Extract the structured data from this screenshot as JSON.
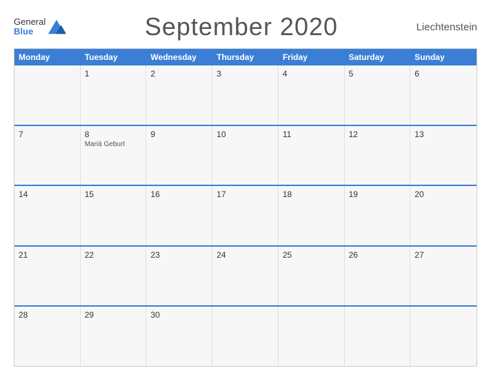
{
  "header": {
    "logo_general": "General",
    "logo_blue": "Blue",
    "title": "September 2020",
    "country": "Liechtenstein"
  },
  "weekdays": [
    "Monday",
    "Tuesday",
    "Wednesday",
    "Thursday",
    "Friday",
    "Saturday",
    "Sunday"
  ],
  "weeks": [
    [
      {
        "day": "",
        "event": ""
      },
      {
        "day": "1",
        "event": ""
      },
      {
        "day": "2",
        "event": ""
      },
      {
        "day": "3",
        "event": ""
      },
      {
        "day": "4",
        "event": ""
      },
      {
        "day": "5",
        "event": ""
      },
      {
        "day": "6",
        "event": ""
      }
    ],
    [
      {
        "day": "7",
        "event": ""
      },
      {
        "day": "8",
        "event": "Mariä Geburt"
      },
      {
        "day": "9",
        "event": ""
      },
      {
        "day": "10",
        "event": ""
      },
      {
        "day": "11",
        "event": ""
      },
      {
        "day": "12",
        "event": ""
      },
      {
        "day": "13",
        "event": ""
      }
    ],
    [
      {
        "day": "14",
        "event": ""
      },
      {
        "day": "15",
        "event": ""
      },
      {
        "day": "16",
        "event": ""
      },
      {
        "day": "17",
        "event": ""
      },
      {
        "day": "18",
        "event": ""
      },
      {
        "day": "19",
        "event": ""
      },
      {
        "day": "20",
        "event": ""
      }
    ],
    [
      {
        "day": "21",
        "event": ""
      },
      {
        "day": "22",
        "event": ""
      },
      {
        "day": "23",
        "event": ""
      },
      {
        "day": "24",
        "event": ""
      },
      {
        "day": "25",
        "event": ""
      },
      {
        "day": "26",
        "event": ""
      },
      {
        "day": "27",
        "event": ""
      }
    ],
    [
      {
        "day": "28",
        "event": ""
      },
      {
        "day": "29",
        "event": ""
      },
      {
        "day": "30",
        "event": ""
      },
      {
        "day": "",
        "event": ""
      },
      {
        "day": "",
        "event": ""
      },
      {
        "day": "",
        "event": ""
      },
      {
        "day": "",
        "event": ""
      }
    ]
  ]
}
